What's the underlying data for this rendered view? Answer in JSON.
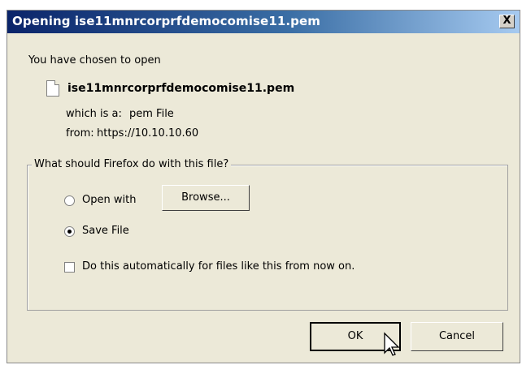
{
  "window": {
    "title": "Opening ise11mnrcorprfdemocomise11.pem",
    "close_glyph": "X"
  },
  "intro": "You have chosen to open",
  "file": {
    "icon": "file-icon",
    "name": "ise11mnrcorprfdemocomise11.pem",
    "type_label": "which is a:",
    "type_value": "pem File",
    "from_label": "from:",
    "from_value": "https://10.10.10.60"
  },
  "action_group": {
    "legend": "What should Firefox do with this file?",
    "open_with_label": "Open with",
    "open_with_selected": false,
    "browse_label": "Browse...",
    "save_file_label": "Save File",
    "save_file_selected": true,
    "auto_checkbox_label": "Do this automatically for files like this from now on.",
    "auto_checked": false
  },
  "buttons": {
    "ok_label": "OK",
    "cancel_label": "Cancel"
  },
  "colors": {
    "title_gradient_start": "#0a246a",
    "title_gradient_end": "#a6caf0",
    "dialog_bg": "#ece9d8"
  }
}
